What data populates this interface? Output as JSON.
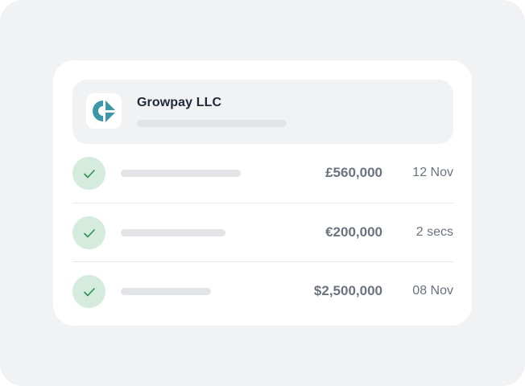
{
  "company": {
    "name": "Growpay LLC",
    "logo_icon": "growpay-logo-icon",
    "logo_color": "#3c98a8"
  },
  "transactions": [
    {
      "amount": "£560,000",
      "date": "12 Nov",
      "status_icon": "check-icon"
    },
    {
      "amount": "€200,000",
      "date": "2 secs",
      "status_icon": "check-icon"
    },
    {
      "amount": "$2,500,000",
      "date": "08 Nov",
      "status_icon": "check-icon"
    }
  ],
  "colors": {
    "background": "#f1f2f4",
    "card": "#ffffff",
    "placeholder_bar": "#e2e4e8",
    "check_bg": "#d4ebdd",
    "check_stroke": "#2f8f52",
    "text_primary": "#1f2937",
    "text_secondary": "#6b7280"
  }
}
